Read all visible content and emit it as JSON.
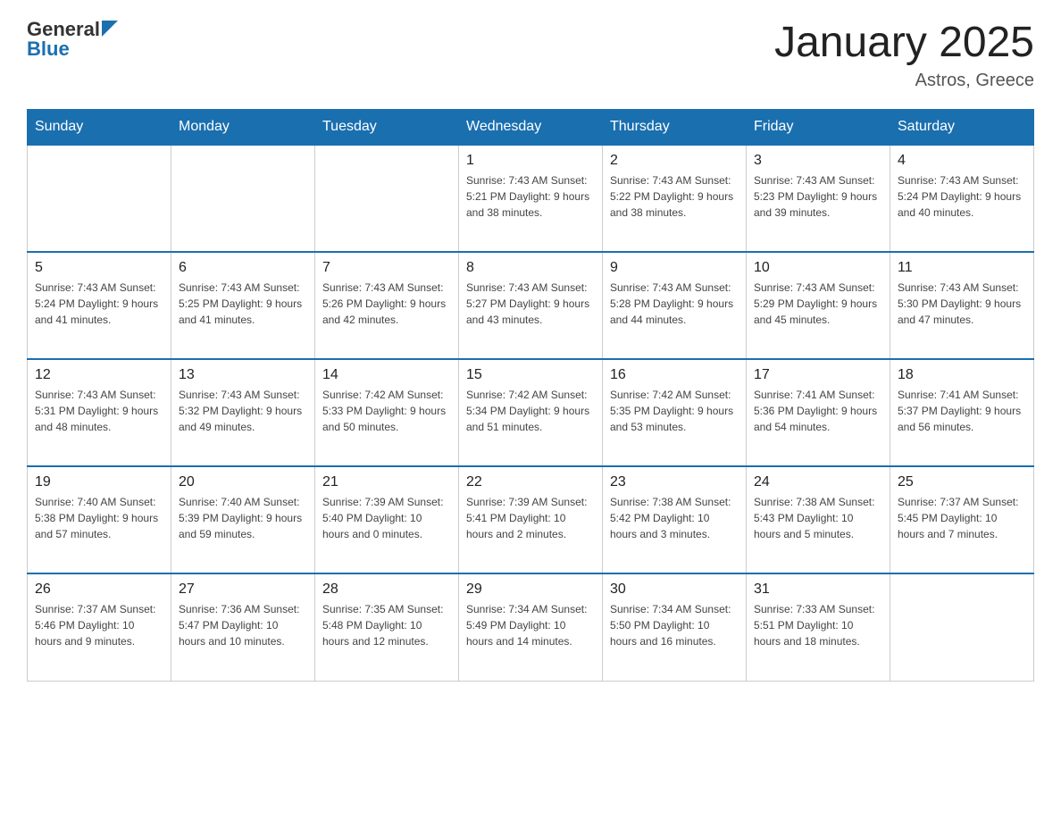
{
  "header": {
    "logo_general": "General",
    "logo_blue": "Blue",
    "title": "January 2025",
    "subtitle": "Astros, Greece"
  },
  "days_of_week": [
    "Sunday",
    "Monday",
    "Tuesday",
    "Wednesday",
    "Thursday",
    "Friday",
    "Saturday"
  ],
  "weeks": [
    [
      {
        "day": "",
        "info": ""
      },
      {
        "day": "",
        "info": ""
      },
      {
        "day": "",
        "info": ""
      },
      {
        "day": "1",
        "info": "Sunrise: 7:43 AM\nSunset: 5:21 PM\nDaylight: 9 hours\nand 38 minutes."
      },
      {
        "day": "2",
        "info": "Sunrise: 7:43 AM\nSunset: 5:22 PM\nDaylight: 9 hours\nand 38 minutes."
      },
      {
        "day": "3",
        "info": "Sunrise: 7:43 AM\nSunset: 5:23 PM\nDaylight: 9 hours\nand 39 minutes."
      },
      {
        "day": "4",
        "info": "Sunrise: 7:43 AM\nSunset: 5:24 PM\nDaylight: 9 hours\nand 40 minutes."
      }
    ],
    [
      {
        "day": "5",
        "info": "Sunrise: 7:43 AM\nSunset: 5:24 PM\nDaylight: 9 hours\nand 41 minutes."
      },
      {
        "day": "6",
        "info": "Sunrise: 7:43 AM\nSunset: 5:25 PM\nDaylight: 9 hours\nand 41 minutes."
      },
      {
        "day": "7",
        "info": "Sunrise: 7:43 AM\nSunset: 5:26 PM\nDaylight: 9 hours\nand 42 minutes."
      },
      {
        "day": "8",
        "info": "Sunrise: 7:43 AM\nSunset: 5:27 PM\nDaylight: 9 hours\nand 43 minutes."
      },
      {
        "day": "9",
        "info": "Sunrise: 7:43 AM\nSunset: 5:28 PM\nDaylight: 9 hours\nand 44 minutes."
      },
      {
        "day": "10",
        "info": "Sunrise: 7:43 AM\nSunset: 5:29 PM\nDaylight: 9 hours\nand 45 minutes."
      },
      {
        "day": "11",
        "info": "Sunrise: 7:43 AM\nSunset: 5:30 PM\nDaylight: 9 hours\nand 47 minutes."
      }
    ],
    [
      {
        "day": "12",
        "info": "Sunrise: 7:43 AM\nSunset: 5:31 PM\nDaylight: 9 hours\nand 48 minutes."
      },
      {
        "day": "13",
        "info": "Sunrise: 7:43 AM\nSunset: 5:32 PM\nDaylight: 9 hours\nand 49 minutes."
      },
      {
        "day": "14",
        "info": "Sunrise: 7:42 AM\nSunset: 5:33 PM\nDaylight: 9 hours\nand 50 minutes."
      },
      {
        "day": "15",
        "info": "Sunrise: 7:42 AM\nSunset: 5:34 PM\nDaylight: 9 hours\nand 51 minutes."
      },
      {
        "day": "16",
        "info": "Sunrise: 7:42 AM\nSunset: 5:35 PM\nDaylight: 9 hours\nand 53 minutes."
      },
      {
        "day": "17",
        "info": "Sunrise: 7:41 AM\nSunset: 5:36 PM\nDaylight: 9 hours\nand 54 minutes."
      },
      {
        "day": "18",
        "info": "Sunrise: 7:41 AM\nSunset: 5:37 PM\nDaylight: 9 hours\nand 56 minutes."
      }
    ],
    [
      {
        "day": "19",
        "info": "Sunrise: 7:40 AM\nSunset: 5:38 PM\nDaylight: 9 hours\nand 57 minutes."
      },
      {
        "day": "20",
        "info": "Sunrise: 7:40 AM\nSunset: 5:39 PM\nDaylight: 9 hours\nand 59 minutes."
      },
      {
        "day": "21",
        "info": "Sunrise: 7:39 AM\nSunset: 5:40 PM\nDaylight: 10 hours\nand 0 minutes."
      },
      {
        "day": "22",
        "info": "Sunrise: 7:39 AM\nSunset: 5:41 PM\nDaylight: 10 hours\nand 2 minutes."
      },
      {
        "day": "23",
        "info": "Sunrise: 7:38 AM\nSunset: 5:42 PM\nDaylight: 10 hours\nand 3 minutes."
      },
      {
        "day": "24",
        "info": "Sunrise: 7:38 AM\nSunset: 5:43 PM\nDaylight: 10 hours\nand 5 minutes."
      },
      {
        "day": "25",
        "info": "Sunrise: 7:37 AM\nSunset: 5:45 PM\nDaylight: 10 hours\nand 7 minutes."
      }
    ],
    [
      {
        "day": "26",
        "info": "Sunrise: 7:37 AM\nSunset: 5:46 PM\nDaylight: 10 hours\nand 9 minutes."
      },
      {
        "day": "27",
        "info": "Sunrise: 7:36 AM\nSunset: 5:47 PM\nDaylight: 10 hours\nand 10 minutes."
      },
      {
        "day": "28",
        "info": "Sunrise: 7:35 AM\nSunset: 5:48 PM\nDaylight: 10 hours\nand 12 minutes."
      },
      {
        "day": "29",
        "info": "Sunrise: 7:34 AM\nSunset: 5:49 PM\nDaylight: 10 hours\nand 14 minutes."
      },
      {
        "day": "30",
        "info": "Sunrise: 7:34 AM\nSunset: 5:50 PM\nDaylight: 10 hours\nand 16 minutes."
      },
      {
        "day": "31",
        "info": "Sunrise: 7:33 AM\nSunset: 5:51 PM\nDaylight: 10 hours\nand 18 minutes."
      },
      {
        "day": "",
        "info": ""
      }
    ]
  ]
}
